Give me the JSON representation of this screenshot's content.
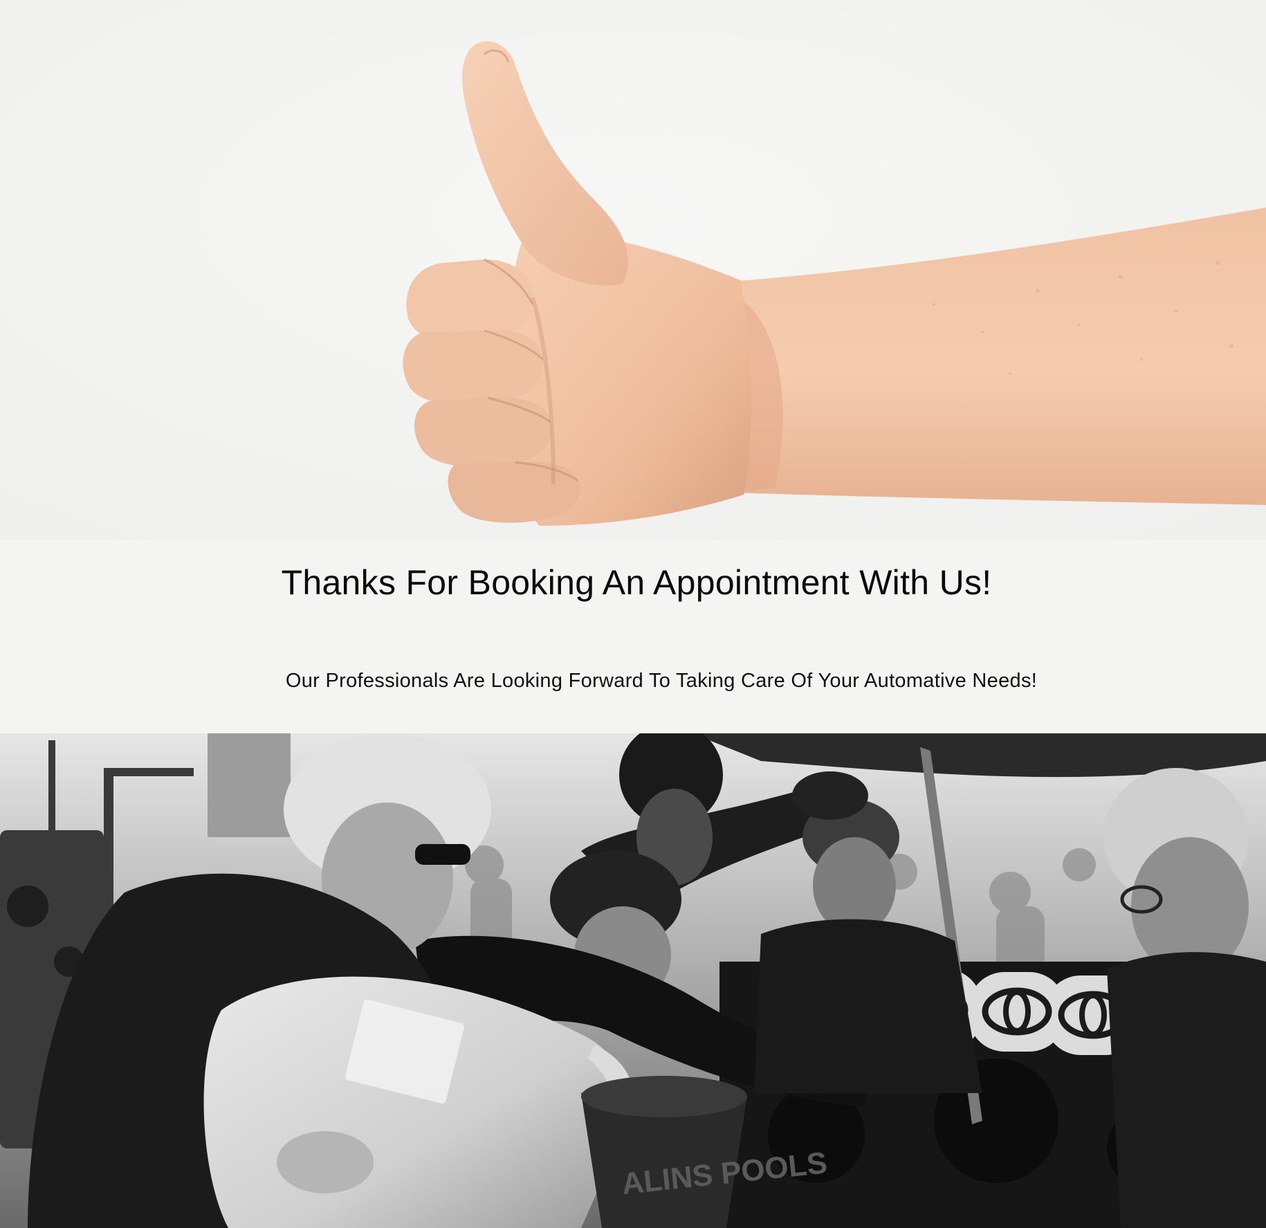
{
  "hero": {
    "image_alt": "Thumbs up hand",
    "skin_color": "#f2c3a6"
  },
  "confirmation": {
    "heading": "Thanks For Booking An Appointment With Us!",
    "subheading": "Our Professionals Are Looking Forward To Taking Care Of Your Automative Needs!"
  },
  "team_photo": {
    "image_alt": "Mechanics working on a race engine",
    "bucket_text": "ALINS POOLS"
  }
}
